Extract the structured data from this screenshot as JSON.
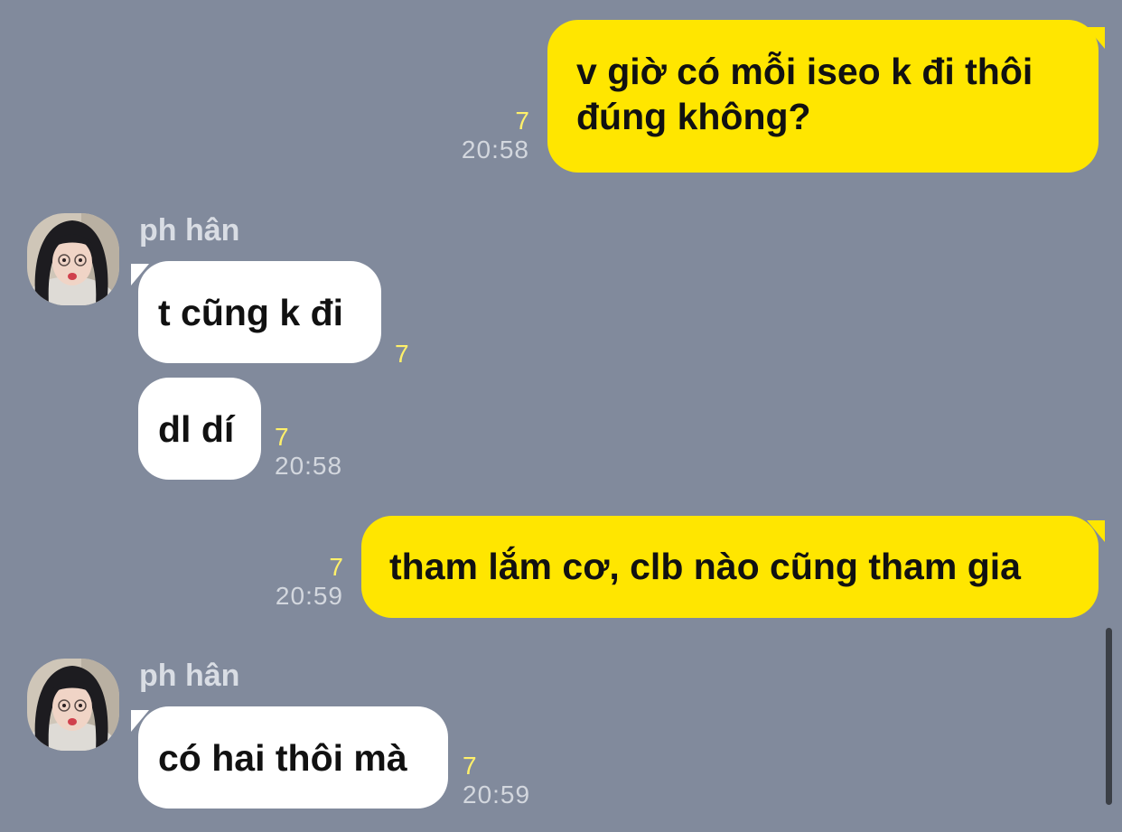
{
  "messages": [
    {
      "direction": "outgoing",
      "text_lines": [
        "v giờ có mỗi iseo k đi thôi",
        "đúng không?"
      ],
      "unread": "7",
      "time": "20:58"
    },
    {
      "direction": "incoming",
      "sender": "ph hân",
      "text": "t cũng k đi",
      "unread": "7"
    },
    {
      "direction": "incoming",
      "text": "dl dí",
      "unread": "7",
      "time": "20:58"
    },
    {
      "direction": "outgoing",
      "text": "tham lắm cơ, clb nào cũng tham gia",
      "unread": "7",
      "time": "20:59"
    },
    {
      "direction": "incoming",
      "sender": "ph hân",
      "text": "có hai thôi mà",
      "unread": "7",
      "time": "20:59"
    }
  ],
  "colors": {
    "background": "#818a9c",
    "outgoing_bubble": "#ffe600",
    "incoming_bubble": "#ffffff",
    "unread_count": "#fff06a",
    "timestamp": "#d3d7de"
  }
}
